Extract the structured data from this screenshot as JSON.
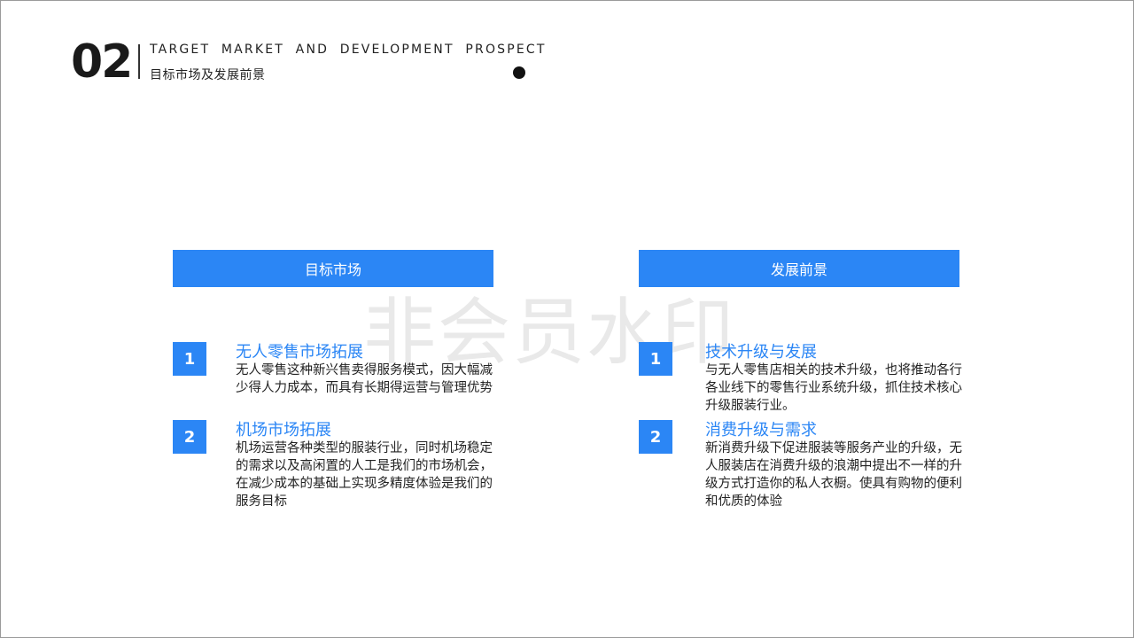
{
  "header": {
    "number": "02",
    "title_en": "TARGET MARKET AND DEVELOPMENT PROSPECT",
    "title_cn": "目标市场及发展前景"
  },
  "watermark": "非会员水印",
  "left_column": {
    "heading": "目标市场",
    "items": [
      {
        "index": "1",
        "title": "无人零售市场拓展",
        "desc": "无人零售这种新兴售卖得服务模式，因大幅减\n少得人力成本，而具有长期得运营与管理优势"
      },
      {
        "index": "2",
        "title": "机场市场拓展",
        "desc": "机场运营各种类型的服装行业，同时机场稳定\n的需求以及高闲置的人工是我们的市场机会，\n在减少成本的基础上实现多精度体验是我们的\n服务目标"
      }
    ]
  },
  "right_column": {
    "heading": "发展前景",
    "items": [
      {
        "index": "1",
        "title": "技术升级与发展",
        "desc": "与无人零售店相关的技术升级，也将推动各行\n各业线下的零售行业系统升级，抓住技术核心\n升级服装行业。"
      },
      {
        "index": "2",
        "title": "消费升级与需求",
        "desc": "新消费升级下促进服装等服务产业的升级，无\n人服装店在消费升级的浪潮中提出不一样的升\n级方式打造你的私人衣橱。使具有购物的便利\n和优质的体验"
      }
    ]
  },
  "colors": {
    "accent": "#2b86f5",
    "text": "#222222"
  }
}
